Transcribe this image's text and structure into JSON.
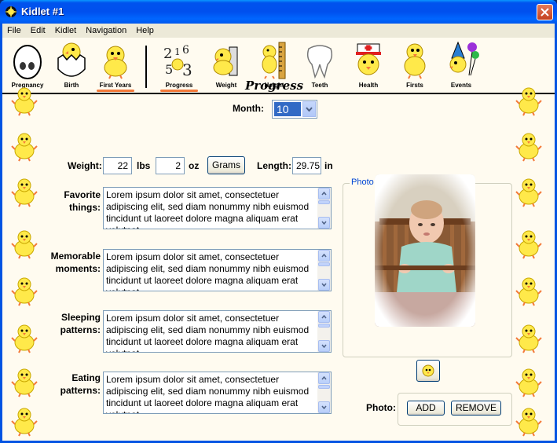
{
  "window": {
    "title": "Kidlet #1"
  },
  "menu": [
    "File",
    "Edit",
    "Kidlet",
    "Navigation",
    "Help"
  ],
  "toolbar": {
    "left": [
      {
        "label": "Pregnancy",
        "icon": "egg-icon"
      },
      {
        "label": "Birth",
        "icon": "hatching-chick-icon"
      },
      {
        "label": "First Years",
        "icon": "chick-icon",
        "active": true
      }
    ],
    "right": [
      {
        "label": "Progress",
        "icon": "numbers-icon",
        "active": true
      },
      {
        "label": "Weight",
        "icon": "scale-chick-icon"
      },
      {
        "label": "Height",
        "icon": "ruler-chick-icon"
      },
      {
        "label": "Teeth",
        "icon": "tooth-icon"
      },
      {
        "label": "Health",
        "icon": "nurse-chick-icon"
      },
      {
        "label": "Firsts",
        "icon": "balloon-chick-icon"
      },
      {
        "label": "Events",
        "icon": "party-chick-icon"
      }
    ]
  },
  "page": {
    "heading": "Progress",
    "month_label": "Month:",
    "month_value": "10",
    "weight_label": "Weight:",
    "weight_lbs": "22",
    "lbs_unit": "lbs",
    "weight_oz": "2",
    "oz_unit": "oz",
    "grams_button": "Grams",
    "length_label": "Length:",
    "length_value": "29.75",
    "length_unit": "in",
    "notes": [
      {
        "label_line1": "Favorite",
        "label_line2": "things:",
        "text": "Lorem ipsum dolor sit amet, consectetuer adipiscing elit, sed diam nonummy nibh euismod tincidunt ut laoreet dolore magna aliquam erat volutpat."
      },
      {
        "label_line1": "Memorable",
        "label_line2": "moments:",
        "text": "Lorem ipsum dolor sit amet, consectetuer adipiscing elit, sed diam nonummy nibh euismod tincidunt ut laoreet dolore magna aliquam erat volutpat."
      },
      {
        "label_line1": "Sleeping",
        "label_line2": "patterns:",
        "text": "Lorem ipsum dolor sit amet, consectetuer adipiscing elit, sed diam nonummy nibh euismod tincidunt ut laoreet dolore magna aliquam erat volutpat."
      },
      {
        "label_line1": "Eating",
        "label_line2": "patterns:",
        "text": "Lorem ipsum dolor sit amet, consectetuer adipiscing elit, sed diam nonummy nibh euismod tincidunt ut laoreet dolore magna aliquam erat volutpat."
      }
    ],
    "photo_group_title": "Photo",
    "photo_label": "Photo:",
    "add_button": "ADD",
    "remove_button": "REMOVE"
  },
  "colors": {
    "titlebar": "#0054e3",
    "background": "#fffbf0",
    "accent": "#f47a3a",
    "chick": "#ffe94a"
  }
}
